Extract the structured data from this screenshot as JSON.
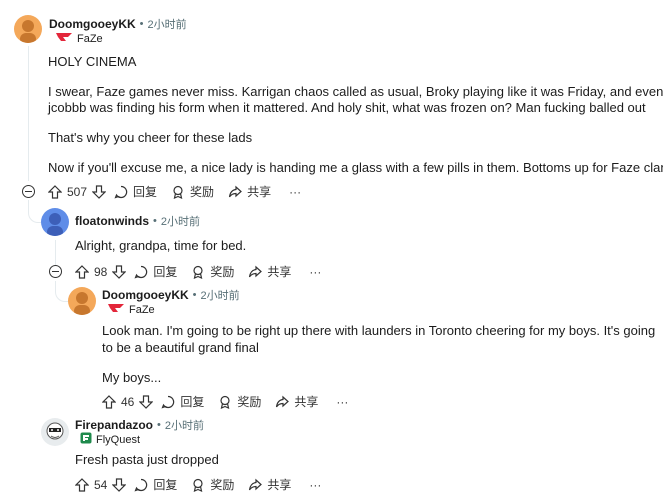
{
  "comments": [
    {
      "username": "DoomgooeyKK",
      "time": "2小时前",
      "flair": "FaZe",
      "paragraphs": [
        "HOLY CINEMA",
        "I swear, Faze games never miss. Karrigan chaos called as usual, Broky playing like it was Friday, and even",
        "jcobbb was finding his form when it mattered. And holy shit, what was frozen on? Man fucking balled out",
        "That's why you cheer for these lads",
        "Now if you'll excuse me, a nice lady is handing me a glass with a few pills in them. Bottoms up for Faze clan!"
      ],
      "votes": "507"
    },
    {
      "username": "floatonwinds",
      "time": "2小时前",
      "paragraphs": [
        "Alright, grandpa, time for bed."
      ],
      "votes": "98"
    },
    {
      "username": "DoomgooeyKK",
      "time": "2小时前",
      "flair": "FaZe",
      "paragraphs": [
        "Look man. I'm going to be right up there with launders in Toronto cheering for my boys. It's going",
        "to be a beautiful grand final",
        "My boys..."
      ],
      "votes": "46"
    },
    {
      "username": "Firepandazoo",
      "time": "2小时前",
      "flair": "FlyQuest",
      "paragraphs": [
        "Fresh pasta just dropped"
      ],
      "votes": "54"
    }
  ],
  "actions": {
    "reply": "回复",
    "award": "奖励",
    "share": "共享",
    "more": "···"
  },
  "colors": {
    "faze_red": "#e3263a",
    "flyquest_green": "#1f8a4c",
    "meta_gray": "#576f76"
  }
}
